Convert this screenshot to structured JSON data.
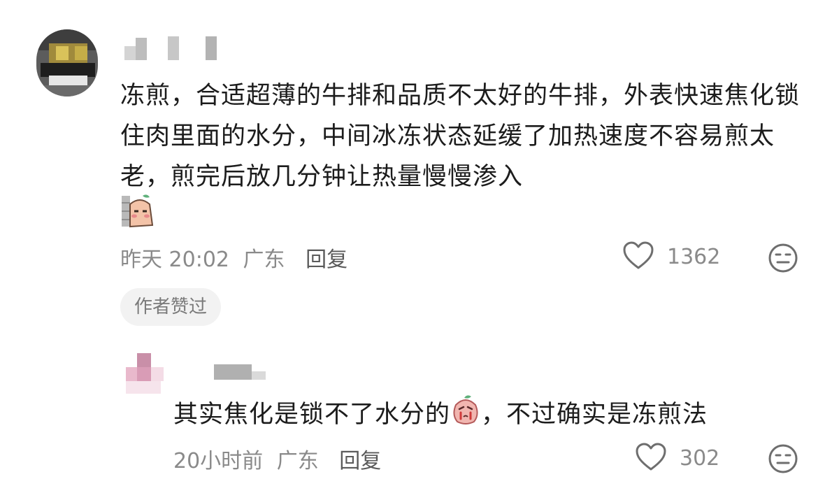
{
  "comment": {
    "text": "冻煎，合适超薄的牛排和品质不太好的牛排，外表快速焦化锁住肉里面的水分，中间冰冻状态延缓了加热速度不容易煎太老，煎完后放几分钟让热量慢慢渗入",
    "sticker_icon": "peeking-peach-sticker",
    "time": "昨天 20:02",
    "location": "广东",
    "reply_label": "回复",
    "likes": "1362",
    "badge": "作者赞过"
  },
  "reply": {
    "text_before": "其实焦化是锁不了水分的",
    "inline_icon": "crying-peach-emoji",
    "text_after": "，不过确实是冻煎法",
    "time": "20小时前",
    "location": "广东",
    "reply_label": "回复",
    "likes": "302"
  },
  "colors": {
    "text": "#1c1c1c",
    "meta": "#8a8a8a",
    "badge_bg": "#f2f2f2"
  }
}
